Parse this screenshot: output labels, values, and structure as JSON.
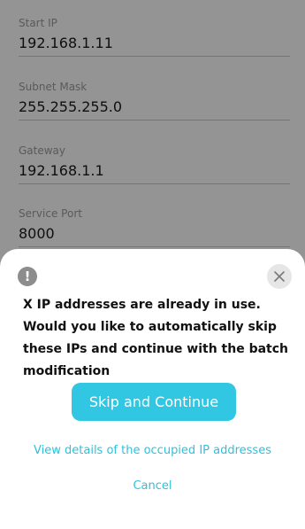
{
  "form": {
    "fields": [
      {
        "label": "Start IP",
        "value": "192.168.1.11"
      },
      {
        "label": "Subnet Mask",
        "value": "255.255.255.0"
      },
      {
        "label": "Gateway",
        "value": "192.168.1.1"
      },
      {
        "label": "Service Port",
        "value": "8000"
      }
    ]
  },
  "dialog": {
    "warning_icon": "exclamation-circle-icon",
    "warning_glyph": "!",
    "close_icon": "close-icon",
    "message": "X IP addresses are already in use. Would you like to automatically skip these IPs and continue with the batch modification",
    "primary_button": "Skip and Continue",
    "details_link": "View details of the occupied IP addresses",
    "cancel_link": "Cancel"
  },
  "colors": {
    "accent": "#31c6e1",
    "link": "#2fc1da",
    "overlay": "rgba(0,0,0,0.42)"
  }
}
